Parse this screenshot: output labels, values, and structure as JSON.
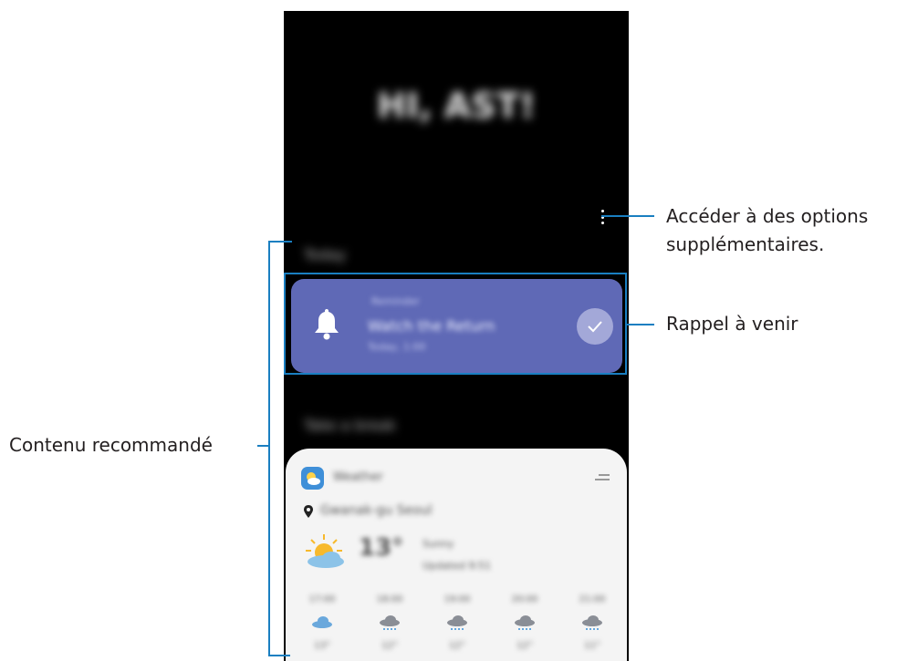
{
  "phone": {
    "greeting": "HI, AST!",
    "section_today": "Today",
    "section_break": "Take a break",
    "reminder": {
      "label": "Reminder",
      "title": "Watch the Return",
      "time": "Today, 1:00"
    },
    "weather": {
      "app": "Weather",
      "location": "Gwanak-gu Seoul",
      "temperature": "13°",
      "detail_1": "Sunny",
      "detail_2": "Updated 9:51",
      "forecast_times": [
        "17:00",
        "18:00",
        "19:00",
        "20:00",
        "21:00"
      ],
      "forecast_temps": [
        "13°",
        "12°",
        "12°",
        "12°",
        "11°"
      ],
      "forecast_icons": [
        "cloud-icon",
        "rain-icon",
        "rain-icon",
        "rain-icon",
        "rain-icon"
      ]
    }
  },
  "callouts": {
    "more_options": [
      "Accéder à des options",
      "supplémentaires."
    ],
    "upcoming_reminder": "Rappel à venir",
    "recommended": "Contenu recommandé"
  },
  "colors": {
    "leader_line": "#1a7fc1",
    "reminder_card": "#5f69b6",
    "screen": "#000000"
  }
}
